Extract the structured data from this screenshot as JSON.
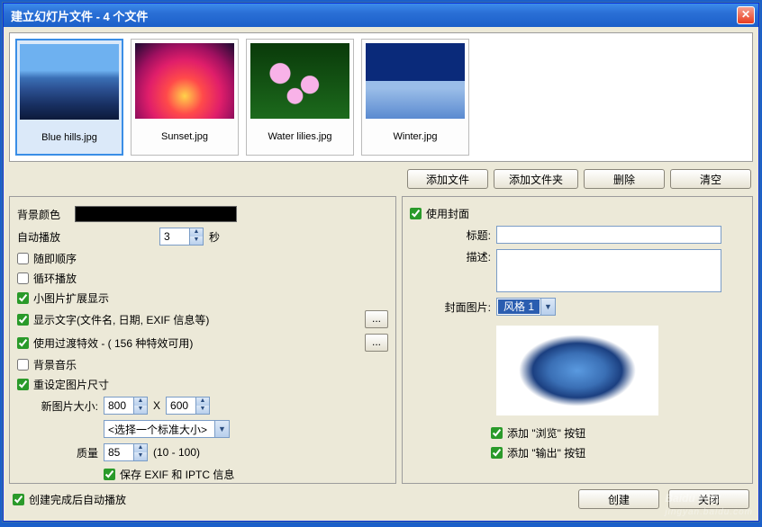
{
  "window": {
    "title": "建立幻灯片文件 - 4 个文件"
  },
  "thumbs": [
    {
      "label": "Blue hills.jpg",
      "selected": true
    },
    {
      "label": "Sunset.jpg",
      "selected": false
    },
    {
      "label": "Water lilies.jpg",
      "selected": false
    },
    {
      "label": "Winter.jpg",
      "selected": false
    }
  ],
  "buttons": {
    "add_file": "添加文件",
    "add_folder": "添加文件夹",
    "delete": "删除",
    "clear": "清空",
    "create": "创建",
    "close": "关闭"
  },
  "left": {
    "bg_color_label": "背景颜色",
    "bg_color_value": "#000000",
    "autoplay_label": "自动播放",
    "autoplay_value": "3",
    "autoplay_unit": "秒",
    "random_order": {
      "label": "随即顺序",
      "checked": false
    },
    "loop": {
      "label": "循环播放",
      "checked": false
    },
    "enlarge_small": {
      "label": "小图片扩展显示",
      "checked": true
    },
    "show_text": {
      "label": "显示文字(文件名, 日期, EXIF 信息等)",
      "checked": true
    },
    "transitions": {
      "label": "使用过渡特效 - ( 156 种特效可用)",
      "checked": true
    },
    "bg_music": {
      "label": "背景音乐",
      "checked": false
    },
    "resize": {
      "label": "重设定图片尺寸",
      "checked": true
    },
    "new_size_label": "新图片大小:",
    "width": "800",
    "height": "600",
    "size_x": "X",
    "preset_label": "<选择一个标准大小>",
    "quality_label": "质量",
    "quality_value": "85",
    "quality_range": "(10 - 100)",
    "preserve_exif": {
      "label": "保存 EXIF 和 IPTC 信息",
      "checked": true
    }
  },
  "right": {
    "use_cover": {
      "label": "使用封面",
      "checked": true
    },
    "title_label": "标题:",
    "title_value": "",
    "desc_label": "描述:",
    "desc_value": "",
    "cover_img_label": "封面图片:",
    "cover_style": "风格 1",
    "add_browse": {
      "label": "添加 \"浏览\" 按钮",
      "checked": true
    },
    "add_export": {
      "label": "添加 \"输出\" 按钮",
      "checked": true
    }
  },
  "bottom": {
    "autoplay_after": {
      "label": "创建完成后自动播放",
      "checked": true
    }
  },
  "watermark": {
    "brand": "Baidu 经验",
    "url": "jingyan.baidu.com"
  }
}
